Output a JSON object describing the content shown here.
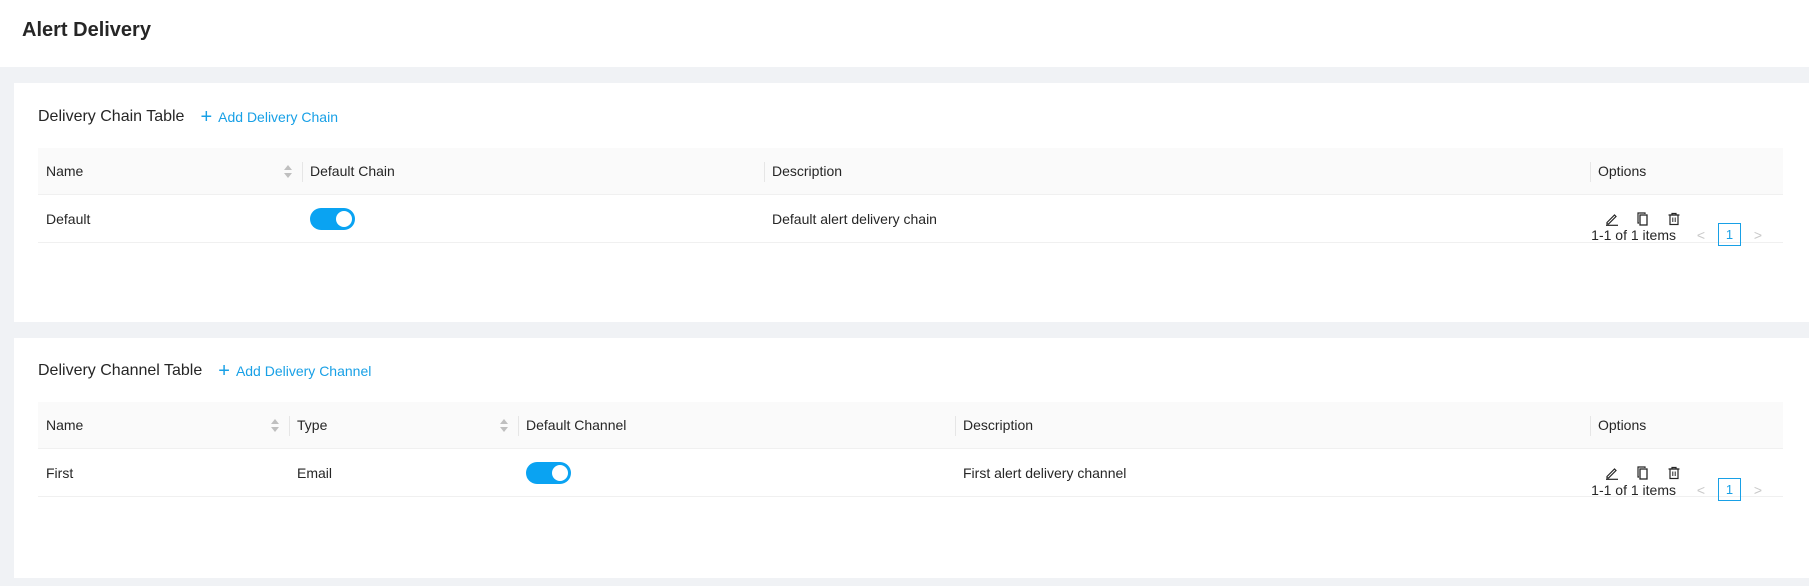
{
  "page": {
    "title": "Alert Delivery"
  },
  "chain_table": {
    "title": "Delivery Chain Table",
    "add_label": "Add Delivery Chain",
    "columns": {
      "name": "Name",
      "default": "Default Chain",
      "description": "Description",
      "options": "Options"
    },
    "rows": [
      {
        "name": "Default",
        "default_on": true,
        "description": "Default alert delivery chain"
      }
    ],
    "pagination": {
      "total_text": "1-1 of 1 items",
      "current": "1",
      "prev": "<",
      "next": ">"
    }
  },
  "channel_table": {
    "title": "Delivery Channel Table",
    "add_label": "Add Delivery Channel",
    "columns": {
      "name": "Name",
      "type": "Type",
      "default": "Default Channel",
      "description": "Description",
      "options": "Options"
    },
    "rows": [
      {
        "name": "First",
        "type": "Email",
        "default_on": true,
        "description": "First alert delivery channel"
      }
    ],
    "pagination": {
      "total_text": "1-1 of 1 items",
      "current": "1",
      "prev": "<",
      "next": ">"
    }
  },
  "icons": {
    "add": "plus-icon",
    "edit": "edit-icon",
    "copy": "copy-icon",
    "delete": "delete-icon",
    "sort": "sort-icon"
  },
  "colors": {
    "accent": "#18a0e6",
    "toggle_on": "#0aa3f2"
  }
}
